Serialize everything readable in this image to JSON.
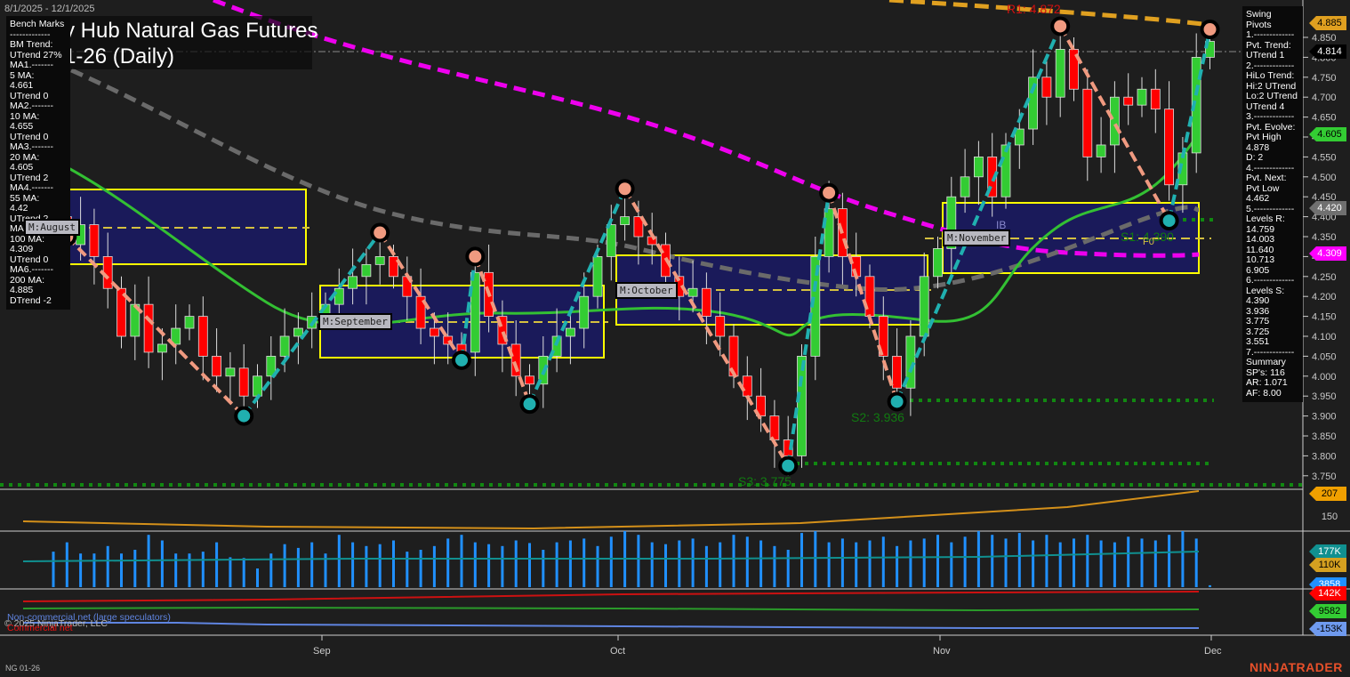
{
  "header": {
    "date_range": "8/1/2025 - 12/1/2025",
    "title_line1": "y Hub Natural Gas Futures",
    "title_line2": "1-26 (Daily)"
  },
  "benchmarks": [
    "Bench Marks",
    "-------------",
    "BM Trend:",
    "UTrend 27%",
    "MA1.-------",
    "5 MA:",
    "4.661",
    "UTrend 0",
    "MA2.-------",
    "10 MA:",
    "4.655",
    "UTrend 0",
    "MA3.-------",
    "20 MA:",
    "4.605",
    "UTrend 2",
    "MA4.-------",
    "55 MA:",
    "4.42",
    "UTrend 2",
    "MA5.-------",
    "100 MA:",
    "4.309",
    "UTrend 0",
    "MA6.-------",
    "200 MA:",
    "4.885",
    "DTrend -2"
  ],
  "swing_pivots": [
    "Swing Pivots",
    "1.-------------",
    "Pvt. Trend:",
    "UTrend 1",
    "2.-------------",
    "HiLo Trend:",
    "Hi:2 UTrend",
    "Lo:2 UTrend",
    "UTrend 4",
    "3.-------------",
    "Pvt. Evolve:",
    "Pvt High",
    "4.878",
    "D: 2",
    "4.-------------",
    "Pvt. Next:",
    "Pvt Low",
    "4.462",
    "5.-------------",
    "Levels R:",
    "14.759",
    "14.003",
    "11.640",
    "10.713",
    "6.905",
    "6.-------------",
    "Levels S:",
    "4.390",
    "3.936",
    "3.775",
    "3.725",
    "3.551",
    "7.-------------",
    "Summary",
    "SP's: 116",
    "AR: 1.071",
    "AF: 8.00"
  ],
  "months": {
    "august": "M:August",
    "september": "M:September",
    "october": "M:October",
    "november": "M:November"
  },
  "levels": {
    "r1": "R1: 4.872",
    "s1": "S1: 4.390",
    "s2": "S2: 3.936",
    "s3": "S3: 3.775",
    "ib": "IB",
    "f0": "F0"
  },
  "axis_tags": [
    {
      "label": "4.885",
      "bg": "#e0a020",
      "fg": "#000"
    },
    {
      "label": "4.814",
      "bg": "#000000",
      "fg": "#fff"
    },
    {
      "label": "4.605",
      "bg": "#33cc33",
      "fg": "#000"
    },
    {
      "label": "4.420",
      "bg": "#707070",
      "fg": "#fff"
    },
    {
      "label": "4.309",
      "bg": "#ff00ff",
      "fg": "#fff"
    },
    {
      "label": "207",
      "bg": "#f0a000",
      "fg": "#000"
    },
    {
      "label": "150",
      "bg": "",
      "fg": "#ccc"
    },
    {
      "label": "177K",
      "bg": "#109090",
      "fg": "#fff"
    },
    {
      "label": "110K",
      "bg": "#d4a020",
      "fg": "#000"
    },
    {
      "label": "3858",
      "bg": "#2090ff",
      "fg": "#fff"
    },
    {
      "label": "142K",
      "bg": "#ff0000",
      "fg": "#fff"
    },
    {
      "label": "9582",
      "bg": "#33cc33",
      "fg": "#000"
    },
    {
      "label": "-153K",
      "bg": "#6f9aee",
      "fg": "#000"
    }
  ],
  "legend": {
    "noncommercial": "Non-commercial net (large speculators)",
    "commercial": "Commercial net",
    "copyright": "© 2025 NinjaTrader, LLC"
  },
  "footer": {
    "instrument": "NG 01-26",
    "brand": "NINJATRADER"
  },
  "chart_data": {
    "type": "candlestick",
    "title": "Henry Hub Natural Gas Futures 01-26 (Daily)",
    "x_month_labels": [
      "Sep",
      "Oct",
      "Nov",
      "Dec"
    ],
    "ylim": [
      3.725,
      4.9
    ],
    "yticks": [
      "4.850",
      "4.800",
      "4.750",
      "4.700",
      "4.650",
      "4.600",
      "4.550",
      "4.500",
      "4.450",
      "4.400",
      "4.350",
      "4.300",
      "4.250",
      "4.200",
      "4.150",
      "4.100",
      "4.050",
      "4.000",
      "3.950",
      "3.900",
      "3.850",
      "3.800",
      "3.750"
    ],
    "closes": [
      4.4,
      4.33,
      4.38,
      4.3,
      4.22,
      4.1,
      4.18,
      4.06,
      4.08,
      4.12,
      4.15,
      4.05,
      4.0,
      4.02,
      3.95,
      4.0,
      4.05,
      4.1,
      4.12,
      4.15,
      4.18,
      4.22,
      4.25,
      4.28,
      4.3,
      4.25,
      4.2,
      4.12,
      4.1,
      4.08,
      4.06,
      4.26,
      4.15,
      4.08,
      4.0,
      3.98,
      4.05,
      4.1,
      4.12,
      4.2,
      4.3,
      4.38,
      4.4,
      4.35,
      4.33,
      4.25,
      4.2,
      4.22,
      4.15,
      4.1,
      4.0,
      3.95,
      3.9,
      3.84,
      3.8,
      4.05,
      4.3,
      4.42,
      4.3,
      4.25,
      4.15,
      4.05,
      3.97,
      4.1,
      4.25,
      4.32,
      4.45,
      4.5,
      4.55,
      4.45,
      4.58,
      4.62,
      4.75,
      4.7,
      4.82,
      4.72,
      4.55,
      4.58,
      4.7,
      4.68,
      4.72,
      4.67,
      4.48,
      4.56,
      4.8,
      4.84
    ],
    "swing_pivots": [
      [
        1,
        4.35
      ],
      [
        14,
        3.9
      ],
      [
        24,
        4.36
      ],
      [
        30,
        4.04
      ],
      [
        31,
        4.3
      ],
      [
        35,
        3.93
      ],
      [
        42,
        4.47
      ],
      [
        54,
        3.775
      ],
      [
        57,
        4.46
      ],
      [
        62,
        3.936
      ],
      [
        74,
        4.878
      ],
      [
        82,
        4.39
      ],
      [
        85,
        4.87
      ]
    ],
    "volume_k": [
      95,
      120,
      90,
      90,
      110,
      90,
      100,
      140,
      125,
      90,
      90,
      95,
      120,
      80,
      78,
      50,
      90,
      115,
      105,
      120,
      90,
      140,
      120,
      110,
      115,
      125,
      95,
      100,
      110,
      130,
      140,
      120,
      115,
      110,
      125,
      118,
      100,
      120,
      125,
      130,
      110,
      135,
      150,
      140,
      120,
      115,
      125,
      130,
      110,
      120,
      140,
      135,
      125,
      110,
      100,
      145,
      150,
      120,
      130,
      120,
      125,
      135,
      110,
      125,
      130,
      140,
      120,
      135,
      150,
      140,
      130,
      145,
      125,
      140,
      120,
      130,
      140,
      125,
      120,
      135,
      130,
      125,
      140,
      150,
      130,
      5
    ]
  }
}
